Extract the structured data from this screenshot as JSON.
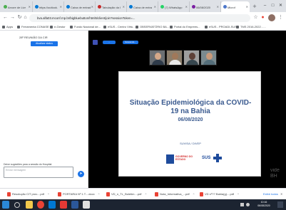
{
  "tabs": [
    {
      "label": "Arvore de Livr",
      "color": "#4caf50",
      "active": false
    },
    {
      "label": "https://outlook.",
      "color": "#0078d4",
      "active": false
    },
    {
      "label": "Caixa de entrad",
      "color": "#0078d4",
      "active": false
    },
    {
      "label": "Tabulação da I",
      "color": "#c62828",
      "active": false
    },
    {
      "label": "Caixa de entra",
      "color": "#0078d4",
      "active": false
    },
    {
      "label": "(7) WhatsApp",
      "color": "#25d366",
      "active": false
    },
    {
      "label": "06/08/2020",
      "color": "#7b1fa2",
      "active": false
    },
    {
      "label": "Microf",
      "color": "#4d77c9",
      "active": true
    }
  ],
  "omnibox": {
    "url": "bva.alfa03.mconf.rnp.br/bigbluebutton/html5/client/join?sessionToken=..."
  },
  "bookmarks": [
    "Apps",
    "Ferramenta CONASE",
    "e-Gestor",
    "Fundo Nacional de...",
    "eSUS - Centro Virtu...",
    "OBSERVATÓRIO BA...",
    "Portal do Emprees...",
    "eSUS - PROADI-SUS",
    "TMS 2016-2022 - ..."
  ],
  "left_panel": {
    "meeting_title": "28º REUNIÃO DA CIR",
    "action_button": "Atualizar status",
    "message_label": "Deixe sugestões para a sessão do Hospital",
    "message_placeholder": "Enviar mensagem"
  },
  "main_panel": {
    "badge_1": "...",
    "badge_2": "Gravando...",
    "slide": {
      "title": "Situação Epidemiológica da COVID-19 na Bahia",
      "date": "06/08/2020",
      "subtitle": "SUVISA / DIVEP",
      "logo_state": "GOVERNO DO ESTADO",
      "logo_sus": "SUS"
    },
    "watermark": "vide\nBH"
  },
  "downloads": [
    {
      "label": "Resolução CIT prov....pdf"
    },
    {
      "label": "PORTARIA Nº 1.T....docx"
    },
    {
      "label": "VD_n_TL_Boletim....pdf"
    },
    {
      "label": "Nota_Informativa_...pdf"
    },
    {
      "label": "VD nº?? Bahia(g)....pdf"
    }
  ],
  "show_all": "Exibir todos",
  "clock": {
    "time": "10:16",
    "date": "06/08/2020"
  }
}
